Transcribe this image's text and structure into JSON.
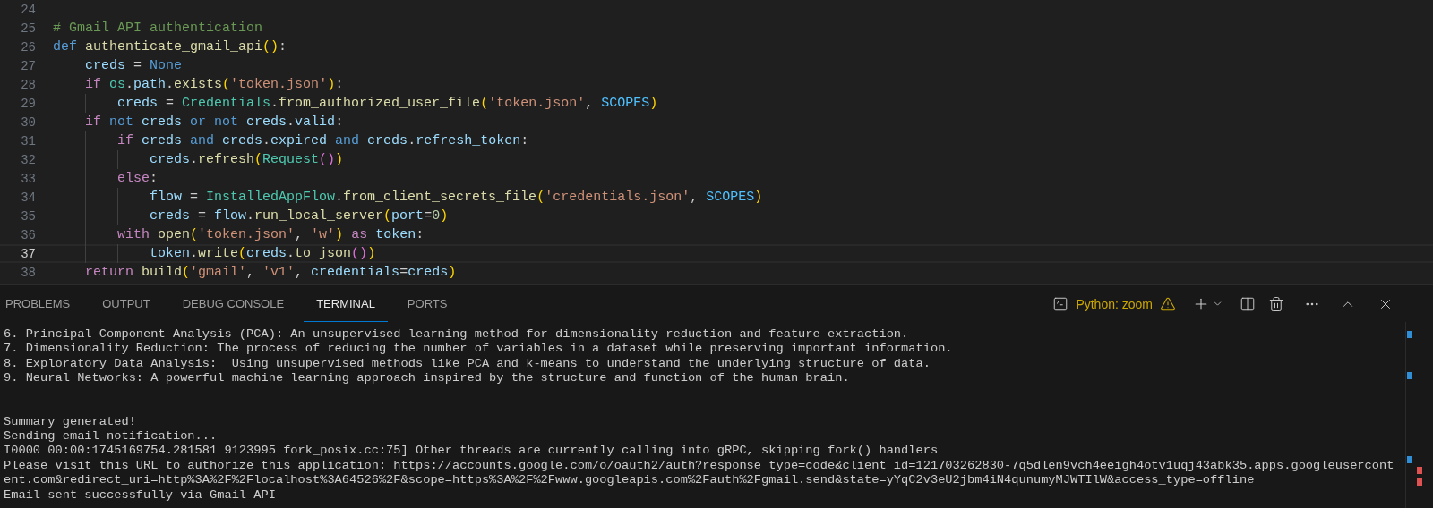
{
  "editor": {
    "lines": [
      {
        "number": "24",
        "current": false
      },
      {
        "number": "25",
        "current": false,
        "tokens": [
          {
            "kind": "comment",
            "text": "# Gmail API authentication"
          }
        ]
      },
      {
        "number": "26",
        "current": false,
        "tokens": [
          {
            "kind": "storage",
            "text": "def"
          },
          {
            "kind": "function",
            "text": " authenticate_gmail_api"
          },
          {
            "kind": "bracket1",
            "text": "()"
          },
          {
            "kind": "punct",
            "text": ":"
          }
        ]
      },
      {
        "number": "27",
        "current": false,
        "tokens": [
          {
            "kind": "variable",
            "text": "    creds"
          },
          {
            "kind": "punct",
            "text": " = "
          },
          {
            "kind": "storage",
            "text": "None"
          }
        ]
      },
      {
        "number": "28",
        "current": false,
        "tokens": [
          {
            "kind": "control",
            "text": "    if"
          },
          {
            "kind": "type",
            "text": " os"
          },
          {
            "kind": "punct",
            "text": "."
          },
          {
            "kind": "variable",
            "text": "path"
          },
          {
            "kind": "punct",
            "text": "."
          },
          {
            "kind": "function",
            "text": "exists"
          },
          {
            "kind": "bracket1",
            "text": "("
          },
          {
            "kind": "string",
            "text": "'token.json'"
          },
          {
            "kind": "bracket1",
            "text": ")"
          },
          {
            "kind": "punct",
            "text": ":"
          }
        ]
      },
      {
        "number": "29",
        "current": false,
        "tokens": [
          {
            "kind": "variable",
            "text": "        creds"
          },
          {
            "kind": "punct",
            "text": " = "
          },
          {
            "kind": "type",
            "text": "Credentials"
          },
          {
            "kind": "punct",
            "text": "."
          },
          {
            "kind": "function",
            "text": "from_authorized_user_file"
          },
          {
            "kind": "bracket1",
            "text": "("
          },
          {
            "kind": "string",
            "text": "'token.json'"
          },
          {
            "kind": "punct",
            "text": ", "
          },
          {
            "kind": "constant",
            "text": "SCOPES"
          },
          {
            "kind": "bracket1",
            "text": ")"
          }
        ]
      },
      {
        "number": "30",
        "current": false,
        "tokens": [
          {
            "kind": "control",
            "text": "    if"
          },
          {
            "kind": "storage",
            "text": " not"
          },
          {
            "kind": "variable",
            "text": " creds"
          },
          {
            "kind": "storage",
            "text": " or"
          },
          {
            "kind": "storage",
            "text": " not"
          },
          {
            "kind": "variable",
            "text": " creds"
          },
          {
            "kind": "punct",
            "text": "."
          },
          {
            "kind": "variable",
            "text": "valid"
          },
          {
            "kind": "punct",
            "text": ":"
          }
        ]
      },
      {
        "number": "31",
        "current": false,
        "tokens": [
          {
            "kind": "control",
            "text": "        if"
          },
          {
            "kind": "variable",
            "text": " creds"
          },
          {
            "kind": "storage",
            "text": " and"
          },
          {
            "kind": "variable",
            "text": " creds"
          },
          {
            "kind": "punct",
            "text": "."
          },
          {
            "kind": "variable",
            "text": "expired"
          },
          {
            "kind": "storage",
            "text": " and"
          },
          {
            "kind": "variable",
            "text": " creds"
          },
          {
            "kind": "punct",
            "text": "."
          },
          {
            "kind": "variable",
            "text": "refresh_token"
          },
          {
            "kind": "punct",
            "text": ":"
          }
        ]
      },
      {
        "number": "32",
        "current": false,
        "tokens": [
          {
            "kind": "variable",
            "text": "            creds"
          },
          {
            "kind": "punct",
            "text": "."
          },
          {
            "kind": "function",
            "text": "refresh"
          },
          {
            "kind": "bracket1",
            "text": "("
          },
          {
            "kind": "type",
            "text": "Request"
          },
          {
            "kind": "bracket2",
            "text": "()"
          },
          {
            "kind": "bracket1",
            "text": ")"
          }
        ]
      },
      {
        "number": "33",
        "current": false,
        "tokens": [
          {
            "kind": "control",
            "text": "        else"
          },
          {
            "kind": "punct",
            "text": ":"
          }
        ]
      },
      {
        "number": "34",
        "current": false,
        "tokens": [
          {
            "kind": "variable",
            "text": "            flow"
          },
          {
            "kind": "punct",
            "text": " = "
          },
          {
            "kind": "type",
            "text": "InstalledAppFlow"
          },
          {
            "kind": "punct",
            "text": "."
          },
          {
            "kind": "function",
            "text": "from_client_secrets_file"
          },
          {
            "kind": "bracket1",
            "text": "("
          },
          {
            "kind": "string",
            "text": "'credentials.json'"
          },
          {
            "kind": "punct",
            "text": ", "
          },
          {
            "kind": "constant",
            "text": "SCOPES"
          },
          {
            "kind": "bracket1",
            "text": ")"
          }
        ]
      },
      {
        "number": "35",
        "current": false,
        "tokens": [
          {
            "kind": "variable",
            "text": "            creds"
          },
          {
            "kind": "punct",
            "text": " = "
          },
          {
            "kind": "variable",
            "text": "flow"
          },
          {
            "kind": "punct",
            "text": "."
          },
          {
            "kind": "function",
            "text": "run_local_server"
          },
          {
            "kind": "bracket1",
            "text": "("
          },
          {
            "kind": "variable",
            "text": "port"
          },
          {
            "kind": "punct",
            "text": "="
          },
          {
            "kind": "number",
            "text": "0"
          },
          {
            "kind": "bracket1",
            "text": ")"
          }
        ]
      },
      {
        "number": "36",
        "current": false,
        "tokens": [
          {
            "kind": "control",
            "text": "        with"
          },
          {
            "kind": "function",
            "text": " open"
          },
          {
            "kind": "bracket1",
            "text": "("
          },
          {
            "kind": "string",
            "text": "'token.json'"
          },
          {
            "kind": "punct",
            "text": ", "
          },
          {
            "kind": "string",
            "text": "'w'"
          },
          {
            "kind": "bracket1",
            "text": ")"
          },
          {
            "kind": "control",
            "text": " as"
          },
          {
            "kind": "variable",
            "text": " token"
          },
          {
            "kind": "punct",
            "text": ":"
          }
        ]
      },
      {
        "number": "37",
        "current": true,
        "tokens": [
          {
            "kind": "variable",
            "text": "            token"
          },
          {
            "kind": "punct",
            "text": "."
          },
          {
            "kind": "function",
            "text": "write"
          },
          {
            "kind": "bracket1",
            "text": "("
          },
          {
            "kind": "variable",
            "text": "creds"
          },
          {
            "kind": "punct",
            "text": "."
          },
          {
            "kind": "function",
            "text": "to_json"
          },
          {
            "kind": "bracket2",
            "text": "()"
          },
          {
            "kind": "bracket1",
            "text": ")"
          }
        ]
      },
      {
        "number": "38",
        "current": false,
        "tokens": [
          {
            "kind": "control",
            "text": "    return"
          },
          {
            "kind": "function",
            "text": " build"
          },
          {
            "kind": "bracket1",
            "text": "("
          },
          {
            "kind": "string",
            "text": "'gmail'"
          },
          {
            "kind": "punct",
            "text": ", "
          },
          {
            "kind": "string",
            "text": "'v1'"
          },
          {
            "kind": "punct",
            "text": ", "
          },
          {
            "kind": "variable",
            "text": "credentials"
          },
          {
            "kind": "punct",
            "text": "="
          },
          {
            "kind": "variable",
            "text": "creds"
          },
          {
            "kind": "bracket1",
            "text": ")"
          }
        ]
      }
    ]
  },
  "panel": {
    "tabs": [
      {
        "label": "PROBLEMS",
        "selected": false
      },
      {
        "label": "OUTPUT",
        "selected": false
      },
      {
        "label": "DEBUG CONSOLE",
        "selected": false
      },
      {
        "label": "TERMINAL",
        "selected": true
      },
      {
        "label": "PORTS",
        "selected": false
      }
    ],
    "terminal_name": "Python: zoom",
    "output": [
      [
        "6. Principal Component Analysis (PCA): An unsupervised learning method for dimensionality reduction and feature extraction.",
        "7. Dimensionality Reduction: The process of reducing the number of variables in a dataset while preserving important information.",
        "8. Exploratory Data Analysis:  Using unsupervised methods like PCA and k-means to understand the underlying structure of data.",
        "9. Neural Networks: A powerful machine learning approach inspired by the structure and function of the human brain."
      ],
      [
        "Summary generated!",
        "Sending email notification...",
        "I0000 00:00:1745169754.281581 9123995 fork_posix.cc:75] Other threads are currently calling into gRPC, skipping fork() handlers",
        "Please visit this URL to authorize this application: https://accounts.google.com/o/oauth2/auth?response_type=code&client_id=121703262830-7q5dlen9vch4eeigh4otv1uqj43abk35.apps.googleusercont",
        "ent.com&redirect_uri=http%3A%2F%2Flocalhost%3A64526%2F&scope=https%3A%2F%2Fwww.googleapis.com%2Fauth%2Fgmail.send&state=yYqC2v3eU2jbm4iN4qunumyMJWTIlW&access_type=offline",
        "Email sent successfully via Gmail API"
      ]
    ]
  }
}
